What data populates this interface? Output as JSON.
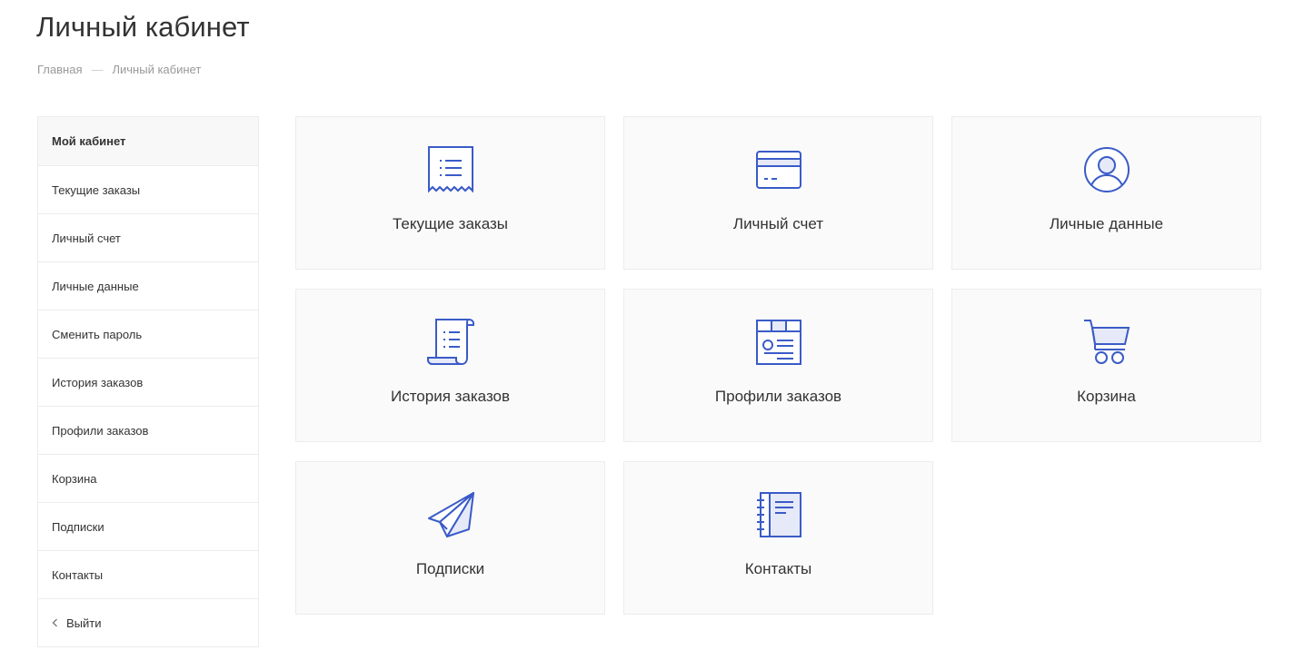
{
  "page": {
    "title": "Личный кабинет"
  },
  "breadcrumb": {
    "home": "Главная",
    "separator": "—",
    "current": "Личный кабинет"
  },
  "accent_color": "#3a5bc7",
  "sidebar": {
    "items": [
      {
        "label": "Мой кабинет",
        "active": true
      },
      {
        "label": "Текущие заказы"
      },
      {
        "label": "Личный счет"
      },
      {
        "label": "Личные данные"
      },
      {
        "label": "Сменить пароль"
      },
      {
        "label": "История заказов"
      },
      {
        "label": "Профили заказов"
      },
      {
        "label": "Корзина"
      },
      {
        "label": "Подписки"
      },
      {
        "label": "Контакты"
      }
    ],
    "logout": {
      "label": "Выйти",
      "icon": "chevron-left-icon"
    }
  },
  "tiles": [
    {
      "label": "Текущие заказы",
      "icon": "receipt-icon"
    },
    {
      "label": "Личный счет",
      "icon": "credit-card-icon"
    },
    {
      "label": "Личные данные",
      "icon": "user-circle-icon"
    },
    {
      "label": "История заказов",
      "icon": "scroll-list-icon"
    },
    {
      "label": "Профили заказов",
      "icon": "profile-card-icon"
    },
    {
      "label": "Корзина",
      "icon": "cart-icon"
    },
    {
      "label": "Подписки",
      "icon": "paper-plane-icon"
    },
    {
      "label": "Контакты",
      "icon": "address-book-icon"
    }
  ]
}
